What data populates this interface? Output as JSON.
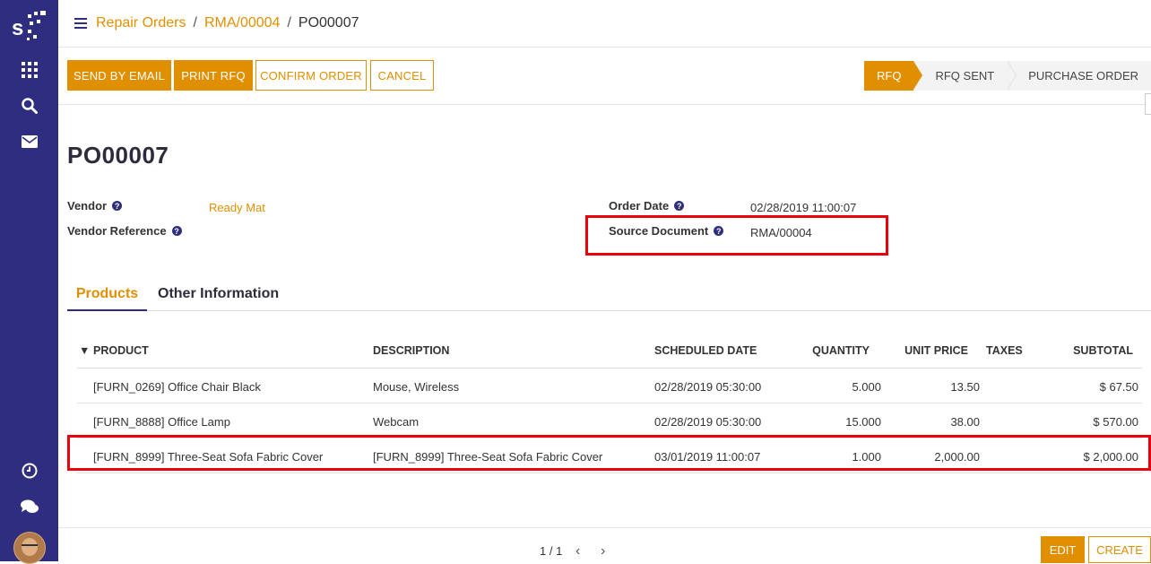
{
  "breadcrumb": {
    "link1": "Repair Orders",
    "link2": "RMA/00004",
    "current": "PO00007",
    "sep": "/"
  },
  "actions": {
    "send_email": "SEND BY EMAIL",
    "print_rfq": "PRINT RFQ",
    "confirm_order": "CONFIRM ORDER",
    "cancel": "CANCEL"
  },
  "status": {
    "steps": [
      "RFQ",
      "RFQ SENT",
      "PURCHASE ORDER"
    ],
    "active": "RFQ"
  },
  "form": {
    "title": "PO00007",
    "vendor_label": "Vendor",
    "vendor_value": "Ready Mat",
    "vendor_ref_label": "Vendor Reference",
    "order_date_label": "Order Date",
    "order_date_value": "02/28/2019 11:00:07",
    "source_doc_label": "Source Document",
    "source_doc_value": "RMA/00004",
    "help_glyph": "?"
  },
  "tabs": {
    "products": "Products",
    "other": "Other Information"
  },
  "table": {
    "headers": {
      "product": "PRODUCT",
      "description": "DESCRIPTION",
      "scheduled_date": "SCHEDULED DATE",
      "quantity": "QUANTITY",
      "unit_price": "UNIT PRICE",
      "taxes": "TAXES",
      "subtotal": "SUBTOTAL"
    },
    "sort_glyph": "▼",
    "rows": [
      {
        "product": "[FURN_0269] Office Chair Black",
        "description": "Mouse, Wireless",
        "scheduled_date": "02/28/2019 05:30:00",
        "quantity": "5.000",
        "unit_price": "13.50",
        "taxes": "",
        "subtotal": "$ 67.50"
      },
      {
        "product": "[FURN_8888] Office Lamp",
        "description": "Webcam",
        "scheduled_date": "02/28/2019 05:30:00",
        "quantity": "15.000",
        "unit_price": "38.00",
        "taxes": "",
        "subtotal": "$ 570.00"
      },
      {
        "product": "[FURN_8999] Three-Seat Sofa Fabric Cover",
        "description": "[FURN_8999] Three-Seat Sofa Fabric Cover",
        "scheduled_date": "03/01/2019 11:00:07",
        "quantity": "1.000",
        "unit_price": "2,000.00",
        "taxes": "",
        "subtotal": "$ 2,000.00"
      }
    ]
  },
  "pager": {
    "text": "1 / 1",
    "prev": "‹",
    "next": "›"
  },
  "footer": {
    "edit": "EDIT",
    "create": "CREATE"
  },
  "colors": {
    "accent": "#e08f00",
    "sidebar": "#2e2d7f",
    "highlight": "#e8000b"
  }
}
